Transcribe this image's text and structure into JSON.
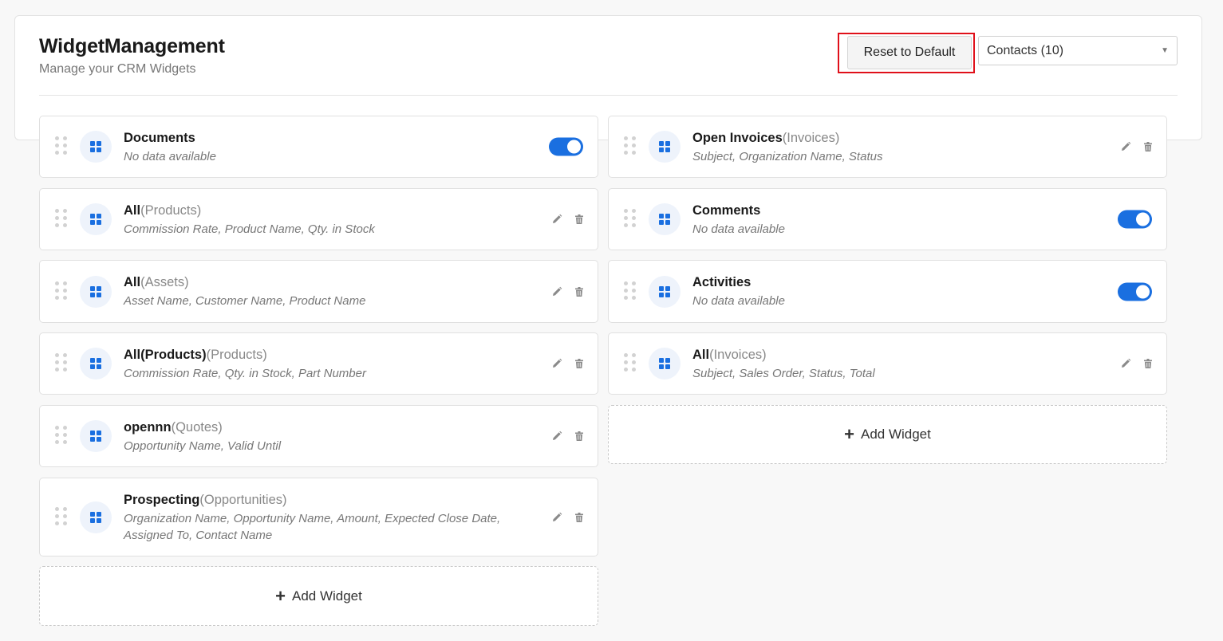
{
  "header": {
    "title": "WidgetManagement",
    "subtitle": "Manage your CRM Widgets",
    "reset_label": "Reset to Default",
    "module_select": "Contacts (10)"
  },
  "left_column": {
    "widgets": [
      {
        "name": "Documents",
        "module": "",
        "fields": "No data available",
        "control": "toggle",
        "enabled": true
      },
      {
        "name": "All",
        "module": "(Products)",
        "fields": "Commission Rate, Product Name, Qty. in Stock",
        "control": "actions"
      },
      {
        "name": "All",
        "module": "(Assets)",
        "fields": "Asset Name, Customer Name, Product Name",
        "control": "actions"
      },
      {
        "name": "All(Products)",
        "module": "(Products)",
        "fields": "Commission Rate, Qty. in Stock, Part Number",
        "control": "actions"
      },
      {
        "name": "opennn",
        "module": "(Quotes)",
        "fields": "Opportunity Name, Valid Until",
        "control": "actions"
      },
      {
        "name": "Prospecting",
        "module": "(Opportunities)",
        "fields": "Organization Name, Opportunity Name, Amount, Expected Close Date, Assigned To, Contact Name",
        "control": "actions"
      }
    ],
    "add_label": "Add Widget"
  },
  "right_column": {
    "widgets": [
      {
        "name": "Open Invoices",
        "module": "(Invoices)",
        "fields": "Subject, Organization Name, Status",
        "control": "actions"
      },
      {
        "name": "Comments",
        "module": "",
        "fields": "No data available",
        "control": "toggle",
        "enabled": true
      },
      {
        "name": "Activities",
        "module": "",
        "fields": "No data available",
        "control": "toggle",
        "enabled": true
      },
      {
        "name": "All",
        "module": "(Invoices)",
        "fields": "Subject, Sales Order, Status, Total",
        "control": "actions"
      }
    ],
    "add_label": "Add Widget"
  },
  "icons": {
    "drag": "drag-handle-icon",
    "widget": "grid-icon",
    "edit": "pencil-icon",
    "delete": "trash-icon",
    "add": "plus-icon",
    "dropdown": "caret-down-icon"
  },
  "colors": {
    "accent": "#1a6fe0",
    "highlight": "#e0101a",
    "background": "#f8f8f8"
  }
}
